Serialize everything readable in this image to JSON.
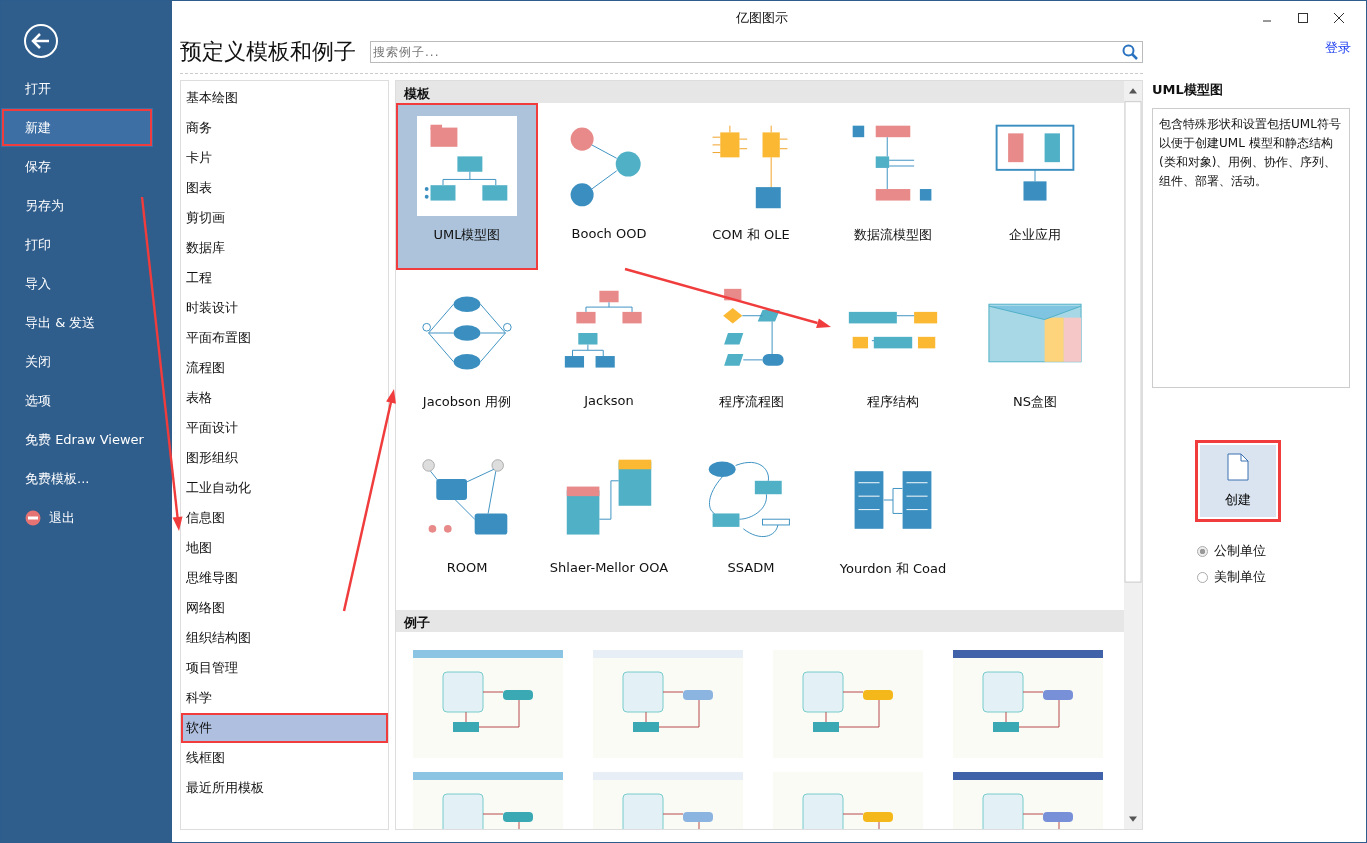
{
  "window": {
    "title": "亿图图示",
    "login": "登录"
  },
  "sidebar": {
    "items": [
      {
        "label": "打开",
        "selected": false,
        "annotated": false,
        "kind": "text"
      },
      {
        "label": "新建",
        "selected": true,
        "annotated": true,
        "kind": "text"
      },
      {
        "label": "保存",
        "selected": false,
        "annotated": false,
        "kind": "text"
      },
      {
        "label": "另存为",
        "selected": false,
        "annotated": false,
        "kind": "text"
      },
      {
        "label": "打印",
        "selected": false,
        "annotated": false,
        "kind": "text"
      },
      {
        "label": "导入",
        "selected": false,
        "annotated": false,
        "kind": "text"
      },
      {
        "label": "导出 & 发送",
        "selected": false,
        "annotated": false,
        "kind": "text"
      },
      {
        "label": "关闭",
        "selected": false,
        "annotated": false,
        "kind": "text"
      },
      {
        "label": "选项",
        "selected": false,
        "annotated": false,
        "kind": "text"
      },
      {
        "label": "免费 Edraw Viewer",
        "selected": false,
        "annotated": false,
        "kind": "text"
      },
      {
        "label": "免费模板...",
        "selected": false,
        "annotated": false,
        "kind": "text"
      },
      {
        "label": "退出",
        "selected": false,
        "annotated": false,
        "kind": "exit"
      }
    ]
  },
  "heading": "预定义模板和例子",
  "search": {
    "placeholder": "搜索例子..."
  },
  "categories": [
    {
      "label": "基本绘图",
      "selected": false,
      "annotated": false
    },
    {
      "label": "商务",
      "selected": false,
      "annotated": false
    },
    {
      "label": "卡片",
      "selected": false,
      "annotated": false
    },
    {
      "label": "图表",
      "selected": false,
      "annotated": false
    },
    {
      "label": "剪切画",
      "selected": false,
      "annotated": false
    },
    {
      "label": "数据库",
      "selected": false,
      "annotated": false
    },
    {
      "label": "工程",
      "selected": false,
      "annotated": false
    },
    {
      "label": "时装设计",
      "selected": false,
      "annotated": false
    },
    {
      "label": "平面布置图",
      "selected": false,
      "annotated": false
    },
    {
      "label": "流程图",
      "selected": false,
      "annotated": false
    },
    {
      "label": "表格",
      "selected": false,
      "annotated": false
    },
    {
      "label": "平面设计",
      "selected": false,
      "annotated": false
    },
    {
      "label": "图形组织",
      "selected": false,
      "annotated": false
    },
    {
      "label": "工业自动化",
      "selected": false,
      "annotated": false
    },
    {
      "label": "信息图",
      "selected": false,
      "annotated": false
    },
    {
      "label": "地图",
      "selected": false,
      "annotated": false
    },
    {
      "label": "思维导图",
      "selected": false,
      "annotated": false
    },
    {
      "label": "网络图",
      "selected": false,
      "annotated": false
    },
    {
      "label": "组织结构图",
      "selected": false,
      "annotated": false
    },
    {
      "label": "项目管理",
      "selected": false,
      "annotated": false
    },
    {
      "label": "科学",
      "selected": false,
      "annotated": false
    },
    {
      "label": "软件",
      "selected": true,
      "annotated": true
    },
    {
      "label": "线框图",
      "selected": false,
      "annotated": false
    },
    {
      "label": "最近所用模板",
      "selected": false,
      "annotated": false
    }
  ],
  "templates": {
    "title": "模板",
    "items": [
      {
        "label": "UML模型图",
        "selected": true,
        "annotated": true
      },
      {
        "label": "Booch OOD",
        "selected": false,
        "annotated": false
      },
      {
        "label": "COM 和 OLE",
        "selected": false,
        "annotated": false
      },
      {
        "label": "数据流模型图",
        "selected": false,
        "annotated": false
      },
      {
        "label": "企业应用",
        "selected": false,
        "annotated": false
      },
      {
        "label": "Jacobson 用例",
        "selected": false,
        "annotated": false
      },
      {
        "label": "Jackson",
        "selected": false,
        "annotated": false
      },
      {
        "label": "程序流程图",
        "selected": false,
        "annotated": false
      },
      {
        "label": "程序结构",
        "selected": false,
        "annotated": false
      },
      {
        "label": "NS盒图",
        "selected": false,
        "annotated": false
      },
      {
        "label": "ROOM",
        "selected": false,
        "annotated": false
      },
      {
        "label": "Shlaer-Mellor OOA",
        "selected": false,
        "annotated": false
      },
      {
        "label": "SSADM",
        "selected": false,
        "annotated": false
      },
      {
        "label": "Yourdon 和 Coad",
        "selected": false,
        "annotated": false
      }
    ]
  },
  "examples": {
    "title": "例子"
  },
  "details": {
    "title": "UML模型图",
    "description": "包含特殊形状和设置包括UML符号以便于创建UML 模型和静态结构(类和对象)、用例、协作、序列、组件、部署、活动。",
    "create_button": {
      "label": "创建",
      "annotated": true
    },
    "units": [
      {
        "label": "公制单位",
        "selected": true
      },
      {
        "label": "美制单位",
        "selected": false
      }
    ]
  }
}
